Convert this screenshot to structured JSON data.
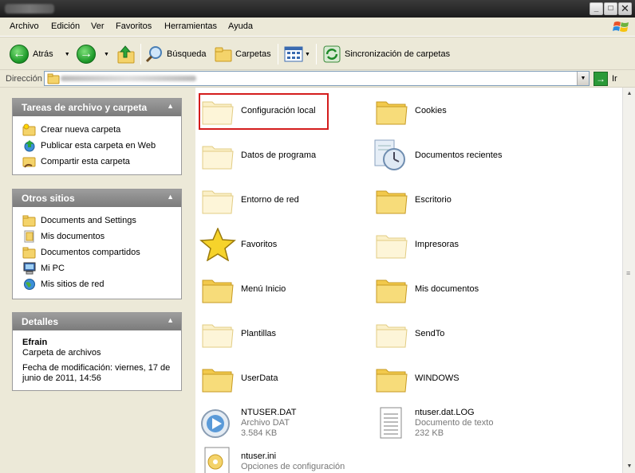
{
  "window": {
    "controls": {
      "minimize": "_",
      "maximize": "□",
      "close": "✕"
    }
  },
  "menu": [
    "Archivo",
    "Edición",
    "Ver",
    "Favoritos",
    "Herramientas",
    "Ayuda"
  ],
  "toolbar": {
    "back_label": "Atrás",
    "search_label": "Búsqueda",
    "folders_label": "Carpetas",
    "sync_label": "Sincronización de carpetas"
  },
  "address": {
    "label": "Dirección",
    "go_label": "Ir"
  },
  "panels": {
    "tasks": {
      "title": "Tareas de archivo y carpeta",
      "items": [
        "Crear nueva carpeta",
        "Publicar esta carpeta en Web",
        "Compartir esta carpeta"
      ]
    },
    "places": {
      "title": "Otros sitios",
      "items": [
        "Documents and Settings",
        "Mis documentos",
        "Documentos compartidos",
        "Mi PC",
        "Mis sitios de red"
      ]
    },
    "details": {
      "title": "Detalles",
      "name": "Efrain",
      "type": "Carpeta de archivos",
      "modified_line1": "Fecha de modificación: viernes, 17 de",
      "modified_line2": "junio de 2011, 14:56"
    }
  },
  "files": [
    {
      "name": "Configuración local",
      "icon": "folder-faded-icon"
    },
    {
      "name": "Cookies",
      "icon": "folder-icon"
    },
    {
      "name": "Datos de programa",
      "icon": "folder-faded-icon"
    },
    {
      "name": "Documentos recientes",
      "icon": "recent-documents-icon"
    },
    {
      "name": "Entorno de red",
      "icon": "folder-faded-icon"
    },
    {
      "name": "Escritorio",
      "icon": "folder-icon"
    },
    {
      "name": "Favoritos",
      "icon": "star-icon"
    },
    {
      "name": "Impresoras",
      "icon": "folder-faded-icon"
    },
    {
      "name": "Menú Inicio",
      "icon": "folder-icon"
    },
    {
      "name": "Mis documentos",
      "icon": "folder-icon"
    },
    {
      "name": "Plantillas",
      "icon": "folder-faded-icon"
    },
    {
      "name": "SendTo",
      "icon": "folder-faded-icon"
    },
    {
      "name": "UserData",
      "icon": "folder-icon"
    },
    {
      "name": "WINDOWS",
      "icon": "folder-icon"
    },
    {
      "name": "NTUSER.DAT",
      "type": "Archivo DAT",
      "size": "3.584 KB",
      "icon": "media-file-icon"
    },
    {
      "name": "ntuser.dat.LOG",
      "type": "Documento de texto",
      "size": "232 KB",
      "icon": "text-document-icon"
    },
    {
      "name": "ntuser.ini",
      "type": "Opciones de configuración",
      "icon": "settings-file-icon"
    }
  ]
}
